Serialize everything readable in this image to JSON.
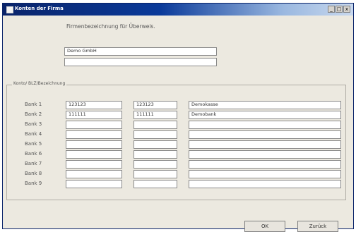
{
  "window": {
    "title": "Konten der Firma",
    "controls": [
      "_",
      "□",
      "x"
    ]
  },
  "firm": {
    "label": "Firmenbezeichnung für Überweis.",
    "line1": "Demo GmbH",
    "line2": ""
  },
  "accounts": {
    "group_title": "Konto/ BLZ/Bezeichnung",
    "rows": [
      {
        "label": "Bank 1",
        "konto": "123123",
        "blz": "123123",
        "bezeichnung": "Demokasse"
      },
      {
        "label": "Bank 2",
        "konto": "111111",
        "blz": "111111",
        "bezeichnung": "Demobank"
      },
      {
        "label": "Bank 3",
        "konto": "",
        "blz": "",
        "bezeichnung": ""
      },
      {
        "label": "Bank 4",
        "konto": "",
        "blz": "",
        "bezeichnung": ""
      },
      {
        "label": "Bank 5",
        "konto": "",
        "blz": "",
        "bezeichnung": ""
      },
      {
        "label": "Bank 6",
        "konto": "",
        "blz": "",
        "bezeichnung": ""
      },
      {
        "label": "Bank 7",
        "konto": "",
        "blz": "",
        "bezeichnung": ""
      },
      {
        "label": "Bank 8",
        "konto": "",
        "blz": "",
        "bezeichnung": ""
      },
      {
        "label": "Bank 9",
        "konto": "",
        "blz": "",
        "bezeichnung": ""
      }
    ]
  },
  "buttons": {
    "ok": "OK",
    "back": "Zurück"
  }
}
